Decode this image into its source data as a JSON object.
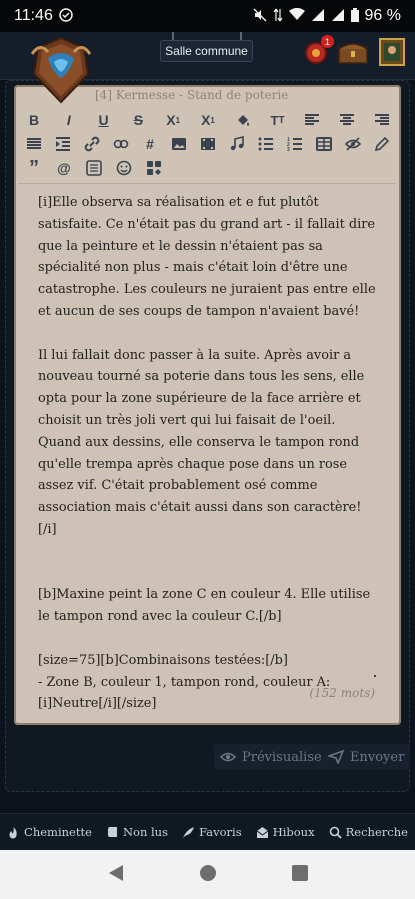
{
  "status_bar": {
    "time": "11:46",
    "battery": "96 %"
  },
  "header": {
    "location": "Salle commune",
    "notification_count": "1"
  },
  "editor": {
    "subject": "[4] Kermesse - Stand de poterie",
    "paragraphs": [
      "[i]Elle observa sa réalisation et e fut plutôt satisfaite. Ce n'était pas du grand art - il fallait dire que la peinture et le dessin n'étaient pas sa spécialité non plus - mais c'était loin d'être une catastrophe. Les couleurs ne juraient pas entre elle et aucun de ses coups de tampon n'avaient bavé!",
      "Il lui fallait donc passer à la suite. Après avoir a nouveau tourné sa poterie dans tous les sens, elle opta pour la zone supérieure de la face arrière et choisit un très joli vert qui lui faisait de l'oeil. Quand aux dessins, elle conserva le tampon rond qu'elle trempa après chaque pose dans un rose assez vif. C'était probablement osé comme association mais c'était aussi dans son caractère![/i]",
      "[b]Maxine peint la zone C en couleur 4. Elle utilise le tampon rond avec la couleur C.[/b]",
      "[size=75][b]Combinaisons testées:[/b]",
      "- Zone B, couleur 1, tampon rond, couleur A:",
      "[i]Neutre[/i][/size]"
    ],
    "word_count": "(152 mots)"
  },
  "actions": {
    "preview": "Prévisualiser",
    "send": "Envoyer"
  },
  "bottom_nav": {
    "items": [
      "Cheminette",
      "Non lus",
      "Favoris",
      "Hiboux",
      "Recherche"
    ]
  },
  "colors": {
    "parchment": "#cfc3b6",
    "dark_bg": "#0f1620",
    "notification": "#d42020"
  }
}
